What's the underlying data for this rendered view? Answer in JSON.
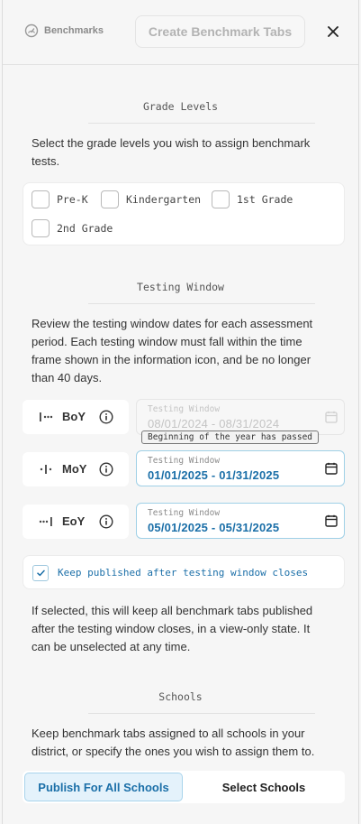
{
  "header": {
    "brand_label": "Benchmarks",
    "create_button_label": "Create Benchmark Tabs"
  },
  "grade_levels": {
    "title": "Grade Levels",
    "description": "Select the grade levels you wish to assign benchmark tests.",
    "options": [
      {
        "label": "Pre-K",
        "checked": false
      },
      {
        "label": "Kindergarten",
        "checked": false
      },
      {
        "label": "1st Grade",
        "checked": false
      },
      {
        "label": "2nd Grade",
        "checked": false
      }
    ]
  },
  "testing_window": {
    "title": "Testing Window",
    "description": "Review the testing window dates for each assessment period. Each testing window must fall within the time frame shown in the information icon, and be no longer than 40 days.",
    "periods": [
      {
        "label": "BoY",
        "field_label": "Testing Window",
        "dates": "08/01/2024 - 08/31/2024",
        "disabled": true
      },
      {
        "label": "MoY",
        "field_label": "Testing Window",
        "dates": "01/01/2025 - 01/31/2025",
        "disabled": false
      },
      {
        "label": "EoY",
        "field_label": "Testing Window",
        "dates": "05/01/2025 - 05/31/2025",
        "disabled": false
      }
    ],
    "tooltip": "Beginning of the year has passed"
  },
  "keep_published": {
    "label": "Keep published after testing window closes",
    "checked": true,
    "description": "If selected, this will keep all benchmark tabs published after the testing window closes, in a view-only state. It can be unselected at any time."
  },
  "schools": {
    "title": "Schools",
    "description": "Keep benchmark tabs assigned to all schools in your district, or specify the ones you wish to assign them to.",
    "options": [
      "Publish For All Schools",
      "Select Schools"
    ],
    "selected": "Publish For All Schools"
  },
  "colors": {
    "accent": "#1b6fa8",
    "accent_light": "#e4f2fb",
    "background": "#f6f6f6"
  }
}
